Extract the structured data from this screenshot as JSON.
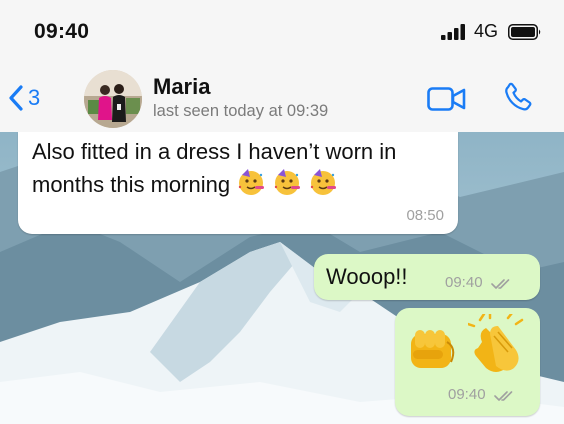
{
  "status_bar": {
    "time": "09:40",
    "network": "4G"
  },
  "header": {
    "back_count": "3",
    "contact_name": "Maria",
    "last_seen": "last seen today at 09:39"
  },
  "messages": [
    {
      "direction": "incoming",
      "text": "Also fitted in a dress I haven’t worn in months this morning",
      "emoji": [
        "partying-face",
        "partying-face",
        "partying-face"
      ],
      "time": "08:50"
    },
    {
      "direction": "outgoing",
      "text": "Wooop!!",
      "time": "09:40",
      "status": "delivered"
    },
    {
      "direction": "outgoing",
      "emoji": [
        "oncoming-fist",
        "clapping-hands"
      ],
      "time": "09:40",
      "status": "delivered"
    }
  ],
  "colors": {
    "accent": "#1a7cf5",
    "outgoing_bubble": "#dcf8c6",
    "incoming_bubble": "#ffffff"
  }
}
